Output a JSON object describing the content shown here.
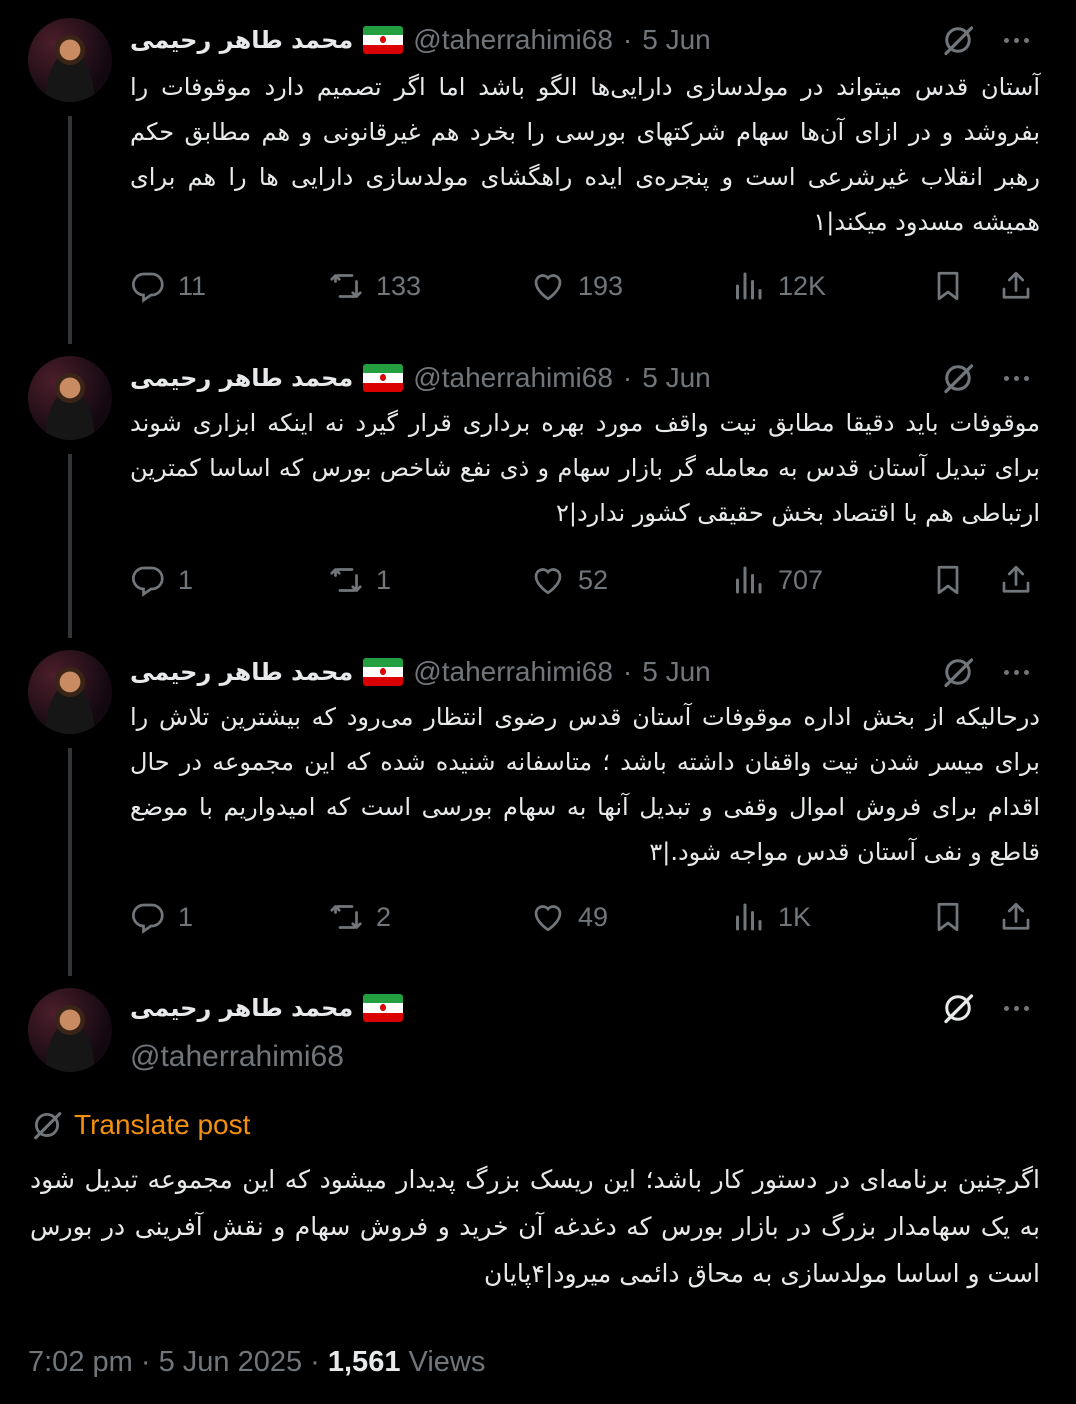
{
  "author": {
    "name": "محمد طاهر رحیمی",
    "handle": "@taherrahimi68",
    "date": "5 Jun"
  },
  "tweets": [
    {
      "text": "آستان قدس میتواند در مولدسازی دارایی‌ها الگو باشد اما اگر تصمیم دارد موقوفات را بفروشد و در ازای آن‌ها سهام شرکتهای بورسی را بخرد هم غیرقانونی و هم مطابق حکم رهبر انقلاب غیرشرعی است و پنجره‌ی ایده راهگشای مولدسازی دارایی ها را هم برای همیشه مسدود میکند|۱",
      "replies": "11",
      "reposts": "133",
      "likes": "193",
      "views": "12K"
    },
    {
      "text": "موقوفات باید دقیقا مطابق نیت واقف مورد بهره برداری قرار گیرد نه اینکه ابزاری شوند برای تبدیل آستان قدس به معامله گر بازار سهام و ذی نفع شاخص بورس که اساسا کمترین ارتباطی هم با اقتصاد بخش حقیقی کشور ندارد|۲",
      "replies": "1",
      "reposts": "1",
      "likes": "52",
      "views": "707"
    },
    {
      "text": "درحالیکه از بخش اداره موقوفات آستان قدس رضوی انتظار می‌رود که بیشترین تلاش را برای میسر شدن نیت واقفان داشته باشد ؛ متاسفانه شنیده شده که این مجموعه در حال اقدام برای فروش اموال وقفی و تبدیل آنها به سهام بورسی است که امیدواریم با موضع قاطع و نفی آستان قدس مواجه شود.|۳",
      "replies": "1",
      "reposts": "2",
      "likes": "49",
      "views": "1K"
    }
  ],
  "main_tweet": {
    "translate_label": "Translate post",
    "text": "اگرچنین برنامه‌ای در دستور کار باشد؛ این ریسک بزرگ پدیدار میشود که این مجموعه تبدیل شود به یک سهامدار بزرگ در بازار بورس که دغدغه آن خرید و فروش سهام و نقش آفرینی در بورس است و اساسا مولدسازی به محاق دائمی میرود|۴پایان",
    "time": "7:02 pm",
    "full_date": "5 Jun 2025",
    "views_count": "1,561",
    "views_label": "Views"
  },
  "colors": {
    "background": "#000000",
    "text": "#e7e9ea",
    "muted": "#71767b",
    "translate": "#f4900c",
    "line": "#333639"
  },
  "icons": [
    "reply-icon",
    "repost-icon",
    "like-icon",
    "views-icon",
    "bookmark-icon",
    "share-icon",
    "grok-icon",
    "more-icon",
    "translate-icon",
    "flag-iran-icon"
  ]
}
